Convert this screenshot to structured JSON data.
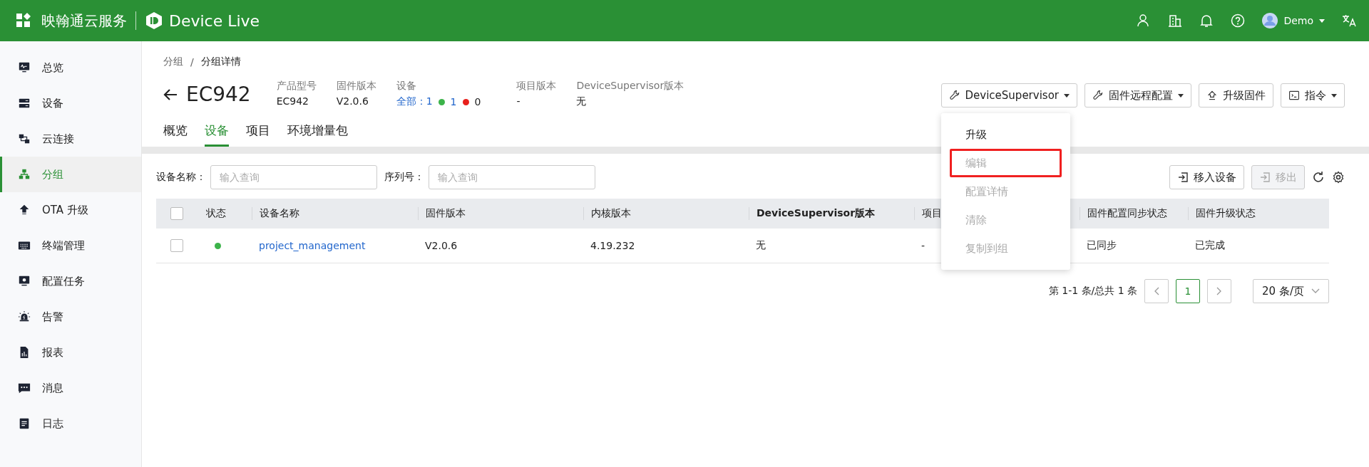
{
  "header": {
    "brand": "映翰通云服务",
    "product": "Device Live",
    "user": "Demo"
  },
  "sidebar": {
    "items": [
      {
        "label": "总览",
        "selected": false
      },
      {
        "label": "设备",
        "selected": false
      },
      {
        "label": "云连接",
        "selected": false
      },
      {
        "label": "分组",
        "selected": true
      },
      {
        "label": "OTA 升级",
        "selected": false
      },
      {
        "label": "终端管理",
        "selected": false
      },
      {
        "label": "配置任务",
        "selected": false
      },
      {
        "label": "告警",
        "selected": false
      },
      {
        "label": "报表",
        "selected": false
      },
      {
        "label": "消息",
        "selected": false
      },
      {
        "label": "日志",
        "selected": false
      }
    ]
  },
  "breadcrumb": {
    "items": [
      "分组",
      "分组详情"
    ],
    "separator": "/"
  },
  "group": {
    "name": "EC942",
    "fields": [
      {
        "label": "产品型号",
        "value": "EC942"
      },
      {
        "label": "固件版本",
        "value": "V2.0.6"
      }
    ],
    "devices": {
      "label": "设备",
      "all": "全部：1",
      "online": "1",
      "offline": "0"
    },
    "fields2": [
      {
        "label": "项目版本",
        "value": "-"
      },
      {
        "label": "DeviceSupervisor版本",
        "value": "无"
      }
    ]
  },
  "actions": [
    {
      "label": "DeviceSupervisor",
      "dropdown": true
    },
    {
      "label": "固件远程配置",
      "dropdown": true
    },
    {
      "label": "升级固件",
      "dropdown": false
    },
    {
      "label": "指令",
      "dropdown": true
    }
  ],
  "menu": [
    {
      "label": "升级",
      "disabled": false,
      "highlighted": false
    },
    {
      "label": "编辑",
      "disabled": true,
      "highlighted": true
    },
    {
      "label": "配置详情",
      "disabled": true,
      "highlighted": false
    },
    {
      "label": "清除",
      "disabled": true,
      "highlighted": false
    },
    {
      "label": "复制到组",
      "disabled": true,
      "highlighted": false
    }
  ],
  "tabs": [
    {
      "label": "概览",
      "selected": false
    },
    {
      "label": "设备",
      "selected": true
    },
    {
      "label": "项目",
      "selected": false
    },
    {
      "label": "环境增量包",
      "selected": false
    }
  ],
  "filters": [
    {
      "label": "设备名称：",
      "placeholder": "输入查询"
    },
    {
      "label": "序列号：",
      "placeholder": "输入查询"
    }
  ],
  "table_buttons": [
    {
      "label": "移入设备",
      "disabled": false
    },
    {
      "label": "移出",
      "disabled": true
    }
  ],
  "table": {
    "all_checked": false,
    "columns": [
      "状态",
      "设备名称",
      "固件版本",
      "内核版本",
      "DeviceSupervisor版本",
      "项目",
      "固件配置同步状态",
      "固件升级状态"
    ],
    "rows": [
      {
        "checked": false,
        "color": "#3cb34a",
        "cells": [
          "",
          "project_management",
          "V2.0.6",
          "4.19.232",
          "无",
          "-",
          "已同步",
          "已完成"
        ]
      }
    ]
  },
  "pagination": {
    "summary": "第 1-1 条/总共 1 条",
    "pages": [
      {
        "label": "1",
        "selected": true
      }
    ],
    "page_size": "20 条/页"
  }
}
